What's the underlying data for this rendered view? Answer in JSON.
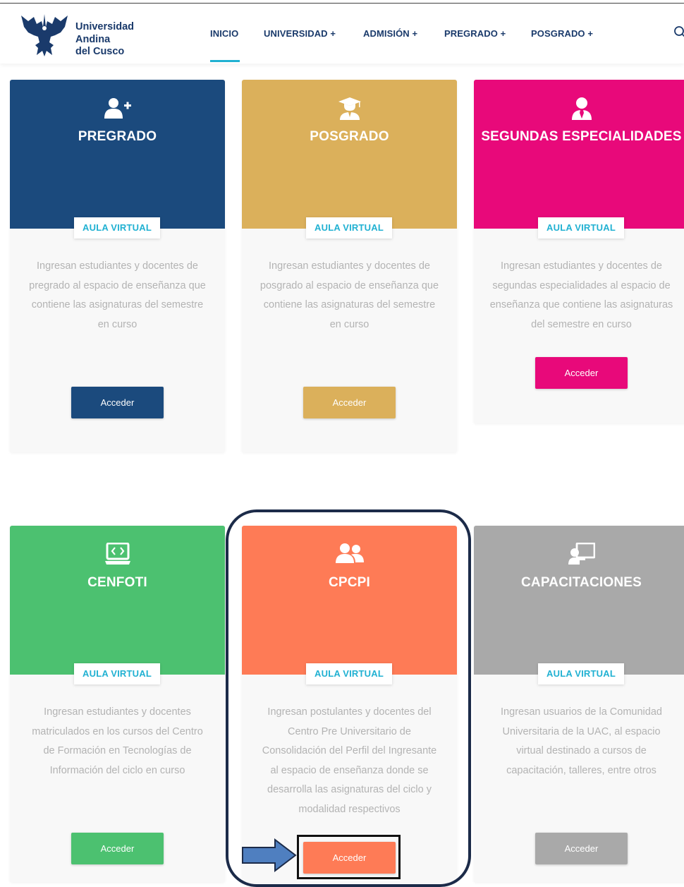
{
  "header": {
    "logo_lines": [
      "Universidad",
      "Andina",
      "del Cusco"
    ],
    "nav": [
      {
        "label": "INICIO",
        "active": true
      },
      {
        "label": "UNIVERSIDAD +"
      },
      {
        "label": "ADMISIÓN +"
      },
      {
        "label": "PREGRADO +"
      },
      {
        "label": "POSGRADO +"
      }
    ],
    "accent": "#21b1d2",
    "brand": "#1a3a6b"
  },
  "cards": [
    {
      "title": "PREGRADO",
      "icon": "user-plus-icon",
      "color": "#1b4a7d",
      "badge": "AULA VIRTUAL",
      "description": [
        "Ingresan estudiantes y docentes de",
        "pregrado al espacio de enseñanza que",
        "contiene las asignaturas del semestre",
        "en curso"
      ],
      "button": "Acceder"
    },
    {
      "title": "POSGRADO",
      "icon": "graduate-icon",
      "color": "#dbb05b",
      "badge": "AULA VIRTUAL",
      "description": [
        "Ingresan estudiantes y docentes de",
        "posgrado al espacio de enseñanza que",
        "contiene las asignaturas del semestre",
        "en curso"
      ],
      "button": "Acceder"
    },
    {
      "title": "SEGUNDAS ESPECIALIDADES",
      "icon": "user-tie-icon",
      "color": "#e8097a",
      "badge": "AULA VIRTUAL",
      "description": [
        "Ingresan estudiantes y docentes de",
        "segundas especialidades al espacio de",
        "enseñanza que contiene las asignaturas",
        "del semestre en curso"
      ],
      "button": "Acceder"
    },
    {
      "title": "CENFOTI",
      "icon": "laptop-code-icon",
      "color": "#4cc170",
      "badge": "AULA VIRTUAL",
      "description": [
        "Ingresan estudiantes y docentes",
        "matriculados en los cursos del Centro",
        "de Formación en Tecnologías de",
        "Información del ciclo en curso"
      ],
      "button": "Acceder"
    },
    {
      "title": "CPCPI",
      "icon": "users-icon",
      "color": "#fe7b56",
      "badge": "AULA VIRTUAL",
      "description": [
        "Ingresan postulantes y docentes del",
        "Centro Pre Universitario de",
        "Consolidación del Perfil del Ingresante",
        "al espacio de enseñanza donde se",
        "desarrolla las asignaturas del ciclo y",
        "modalidad respectivos"
      ],
      "button": "Acceder"
    },
    {
      "title": "CAPACITACIONES",
      "icon": "chalkboard-teacher-icon",
      "color": "#a9a9a9",
      "badge": "AULA VIRTUAL",
      "description": [
        "Ingresan usuarios de la Comunidad",
        "Universitaria de la UAC, al espacio",
        "virtual destinado a cursos de",
        "capacitación, talleres, entre otros"
      ],
      "button": "Acceder"
    }
  ]
}
